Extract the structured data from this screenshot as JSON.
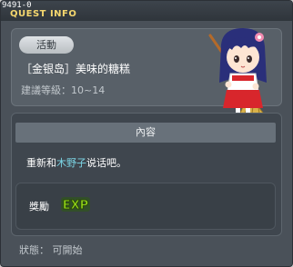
{
  "window": {
    "quest_id": "9491-0",
    "title": "QUEST INFO"
  },
  "quest": {
    "category_tag": "活動",
    "name": "［金银岛］美味的糖糕",
    "level_recommendation": "建議等級：10~14"
  },
  "content": {
    "header": "內容",
    "description_prefix": "重新和",
    "npc_name": "木野子",
    "description_suffix": "说话吧。"
  },
  "reward": {
    "label": "獎勵",
    "exp_icon_text": "EXP"
  },
  "status": {
    "text": "狀態： 可開始"
  },
  "colors": {
    "title": "#f5d76e",
    "npc_highlight": "#7cd6e6",
    "exp_green": "#9be11a"
  }
}
